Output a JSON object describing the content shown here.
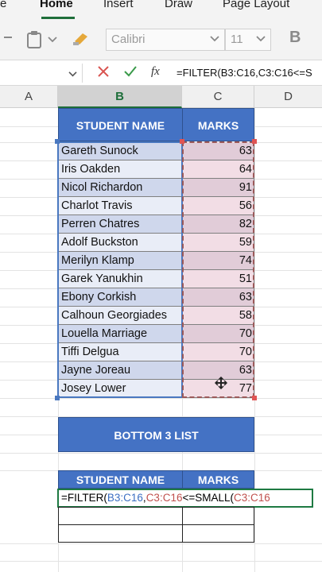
{
  "ribbon": {
    "tabs": [
      "e",
      "Home",
      "Insert",
      "Draw",
      "Page Layout"
    ],
    "font_name": "Calibri",
    "font_size": "11",
    "bold_label": "B"
  },
  "formula_bar": {
    "fx_label": "fx",
    "formula": "=FILTER(B3:C16,C3:C16<=S"
  },
  "columns": [
    "A",
    "B",
    "C",
    "D"
  ],
  "table": {
    "headers": [
      "STUDENT NAME",
      "MARKS"
    ],
    "rows": [
      {
        "name": "Gareth  Sunock",
        "marks": "63"
      },
      {
        "name": "Iris  Oakden",
        "marks": "64"
      },
      {
        "name": "Nicol  Richardon",
        "marks": "91"
      },
      {
        "name": "Charlot  Travis",
        "marks": "56"
      },
      {
        "name": "Perren  Chatres",
        "marks": "82"
      },
      {
        "name": "Adolf  Buckston",
        "marks": "59"
      },
      {
        "name": "Merilyn  Klamp",
        "marks": "74"
      },
      {
        "name": "Garek  Yanukhin",
        "marks": "51"
      },
      {
        "name": "Ebony  Corkish",
        "marks": "63"
      },
      {
        "name": "Calhoun  Georgiades",
        "marks": "58"
      },
      {
        "name": "Louella  Marriage",
        "marks": "70"
      },
      {
        "name": "Tiffi  Delgua",
        "marks": "70"
      },
      {
        "name": "Jayne  Joreau",
        "marks": "63"
      },
      {
        "name": "Josey  Lower",
        "marks": "77"
      }
    ]
  },
  "bottom": {
    "title": "BOTTOM 3 LIST",
    "headers": [
      "STUDENT NAME",
      "MARKS"
    ],
    "edit_parts": [
      "=FILTER(",
      "B3:C16",
      ",",
      "C3:C16",
      "<=SMALL(",
      "C3:C16"
    ]
  },
  "colors": {
    "header_blue": "#4472c4",
    "excel_green": "#1e6e3a",
    "ref_blue": "#3b6fc2",
    "ref_red": "#c0504d"
  }
}
